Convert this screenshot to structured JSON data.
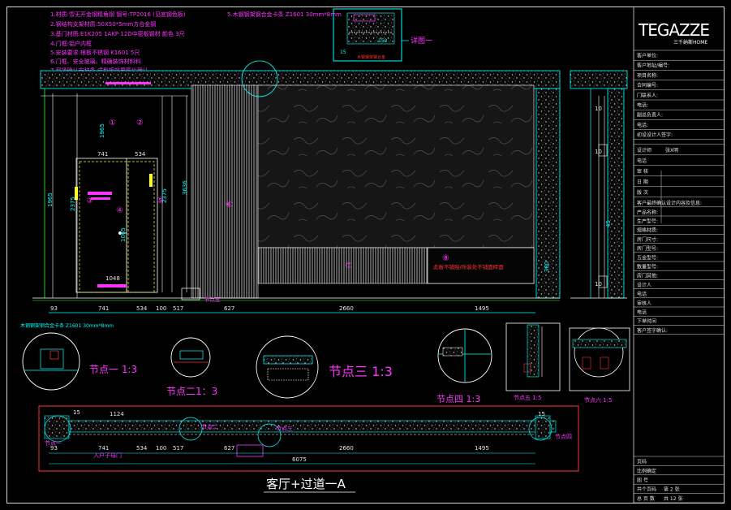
{
  "notes": {
    "lines": [
      "1.材质:雪无开金钢精角钢 钢号:TP2016 (见底钢色板)",
      "2.钢结构支架材质:50X50*5mm方合金钢",
      "3.基门材质:E1K205 1AKP 12D中密板钢材 颜色 3尺",
      "4.门框:铝户内框",
      "5.安装要求:根板不锈钢 K1601 5尺",
      "6.门框、安全玻璃、精确装饰材料料",
      "7.现场确认安装条 成型板效果图片确认"
    ],
    "steel_note": "5.木钢钢架钢合金卡条 Z1601 30mm*8mm"
  },
  "callouts": {
    "detail_one_label": "详图一",
    "detail_box_dims": [
      "150",
      "15"
    ],
    "detail_box_note": "木钢钢架钢合金"
  },
  "elevation": {
    "circle_marks": [
      "①",
      "②",
      "③",
      "④",
      "⑤",
      "⑥",
      "⑦",
      "⑧"
    ],
    "panel_note": "此板不铺贴/所装处不铺面砖面",
    "vertical_dims": [
      "1965",
      "2375",
      "3636",
      "2375",
      "1965",
      "380"
    ],
    "door_widths": [
      "741",
      "534"
    ],
    "door_center": "1065",
    "door_bottom": "1048",
    "bottom_dims": [
      "93",
      "741",
      "534",
      "100",
      "517",
      "627",
      "2660",
      "1495"
    ],
    "node_marker": "节点五",
    "bottom_left_note": "木钢钢架钢合金卡条 Z1601 30mm*8mm"
  },
  "side_section": {
    "dims": [
      "10",
      "10",
      "45",
      "10"
    ]
  },
  "details": {
    "node_one": "节点一 1:3",
    "node_two": "节点二1：3",
    "node_three": "节点三 1:3",
    "node_four": "节点四 1:3",
    "node_five": "节点五 1:5",
    "node_six": "节点六 1:5"
  },
  "plan": {
    "dims_top": [
      "15",
      "1124"
    ],
    "dims_bottom": [
      "93",
      "741",
      "534",
      "100",
      "517",
      "627",
      "2660",
      "1495"
    ],
    "total": "6075",
    "right_dim": "15",
    "labels": [
      "节点一",
      "入户子母门",
      "节点二",
      "节点三",
      "节点四"
    ]
  },
  "title": "客厅+过道一A",
  "title_block": {
    "brand": "TEGAZZE",
    "brand_sub": "三千纳斯HOME",
    "rows_top": [
      "客户单位:",
      "客户地址/编号:",
      "项目名称:",
      "合同编号:",
      "门联系人:",
      "电话:",
      "副总负责人:",
      "电话:",
      "初设设计人签字:"
    ],
    "design_rows": [
      [
        "设计师",
        "张X明"
      ],
      [
        "电话",
        ""
      ],
      [
        "审 核",
        ""
      ],
      [
        "日 期",
        ""
      ],
      [
        "版 次",
        ""
      ]
    ],
    "confirm_title": "客户最终确认设计内容及信息:",
    "confirm_rows": [
      "产品名称:",
      "生产型号:",
      "规格材质:",
      "房门尺寸:",
      "房门型号:",
      "五金型号:",
      "数量型号:",
      "房门其他:",
      "设计人",
      "电话",
      "审核人",
      "电话",
      "下单时间",
      "客户签字确认:"
    ],
    "bottom_rows": [
      [
        "页码",
        ""
      ],
      [
        "比例确定",
        ""
      ],
      [
        "图 号",
        ""
      ],
      [
        "共个页码",
        "第 2 张"
      ],
      [
        "总 页 数",
        "共 12 张"
      ]
    ]
  },
  "colors": {
    "frame": "#d8d8d8",
    "cyan": "#00ffff",
    "magenta": "#ff33ff",
    "green": "#33ff33",
    "red": "#ff3333",
    "yellow": "#ffff33"
  }
}
